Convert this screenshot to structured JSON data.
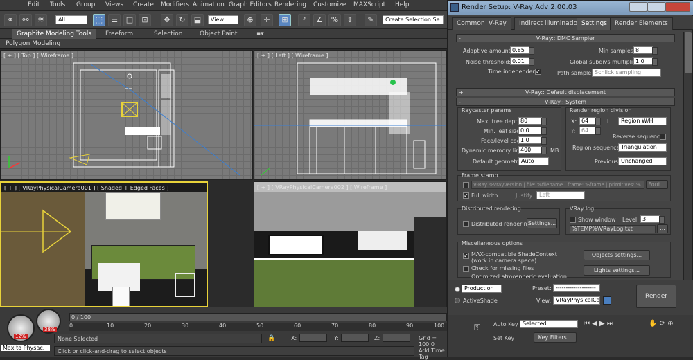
{
  "menu": [
    "Edit",
    "Tools",
    "Group",
    "Views",
    "Create",
    "Modifiers",
    "Animation",
    "Graph Editors",
    "Rendering",
    "Customize",
    "MAXScript",
    "Help"
  ],
  "toolbar": {
    "filter": "All",
    "view": "View",
    "selection_set": "Create Selection Se"
  },
  "ribbon": {
    "tabs": [
      "Graphite Modeling Tools",
      "Freeform",
      "Selection",
      "Object Paint"
    ],
    "subtab": "Polygon Modeling"
  },
  "viewports": {
    "top": "[ + ] [ Top ] [ Wireframe ]",
    "left": "[ + ] [ Left ] [ Wireframe ]",
    "camera": "[ + ] [ VRayPhysicalCamera001 ] [ Shaded + Edged Faces ]",
    "perspective": "[ + ] [ VRayPhysicalCamera002 ] [ Wireframe ]"
  },
  "timeline": {
    "frame_counter": "0 / 100",
    "ticks": [
      "0",
      "10",
      "20",
      "30",
      "40",
      "50",
      "60",
      "70",
      "80",
      "90",
      "100"
    ],
    "status": "None Selected",
    "prompt": "Click or click-and-drag to select objects",
    "x_label": "X:",
    "y_label": "Y:",
    "z_label": "Z:",
    "grid": "Grid = 100.0",
    "add_time_tag": "Add Time Tag",
    "maxscript": "Max to Physac.",
    "auto_key": "Auto Key",
    "set_key": "Set Key",
    "selected": "Selected",
    "key_filters": "Key Filters...",
    "gauge1": "12%",
    "gauge2": "38%"
  },
  "dialog": {
    "title": "Render Setup: V-Ray Adv 2.00.03",
    "tabs": [
      "Common",
      "V-Ray",
      "Indirect illumination",
      "Settings",
      "Render Elements"
    ],
    "dmc": {
      "header": "V-Ray:: DMC Sampler",
      "adaptive_label": "Adaptive amount:",
      "adaptive": "0.85",
      "noise_label": "Noise threshold:",
      "noise": "0.01",
      "time_label": "Time independent",
      "time_check": "✓",
      "min_samples_label": "Min samples:",
      "min_samples": "8",
      "subdivs_label": "Global subdivs multiplier:",
      "subdivs": "1.0",
      "path_label": "Path sampler:",
      "path": "Schlick sampling"
    },
    "displacement_header": "V-Ray:: Default displacement",
    "system": {
      "header": "V-Ray:: System",
      "raycaster": "Raycaster params",
      "max_tree_label": "Max. tree depth:",
      "max_tree": "80",
      "min_leaf_label": "Min. leaf size:",
      "min_leaf": "0.0",
      "face_coef_label": "Face/level coef.",
      "face_coef": "1.0",
      "dyn_mem_label": "Dynamic memory limit:",
      "dyn_mem": "400",
      "mb": "MB",
      "default_geom_label": "Default geometry:",
      "default_geom": "Auto",
      "region": "Render region division",
      "x_label": "X:",
      "x": "64",
      "l": "L",
      "y_label": "Y:",
      "y": "64",
      "region_mode": "Region W/H",
      "reverse": "Reverse sequence",
      "seq_label": "Region sequence:",
      "seq": "Triangulation",
      "prev_label": "Previous",
      "prev": "Unchanged",
      "frame_stamp": "Frame stamp",
      "stamp_text": "V-Ray %vrayversion | file: %filename | frame: %frame | primitives: %",
      "font": "Font...",
      "full_width": "Full width",
      "full_check": "✓",
      "justify_label": "Justify:",
      "justify": "Left",
      "distributed": "Distributed rendering",
      "dist_check_label": "Distributed rendering",
      "dist_settings": "Settings...",
      "vlog": "VRay log",
      "show_window": "Show window",
      "level_label": "Level:",
      "level": "3",
      "log_path": "%TEMP%\\VRayLog.txt",
      "misc": "Miscellaneous options",
      "max_compat": "MAX-compatible ShadeContext",
      "max_compat_check": "✓",
      "camera_space": "(work in camera space)",
      "check_missing": "Check for missing files",
      "optimized": "Optimized atmospheric evaluation",
      "objects_settings": "Objects settings...",
      "lights_settings": "Lights settings..."
    },
    "footer": {
      "production": "Production",
      "activeshade": "ActiveShade",
      "preset_label": "Preset:",
      "preset": "--------------------",
      "view_label": "View:",
      "view": "VRayPhysicalCa",
      "render": "Render"
    }
  }
}
